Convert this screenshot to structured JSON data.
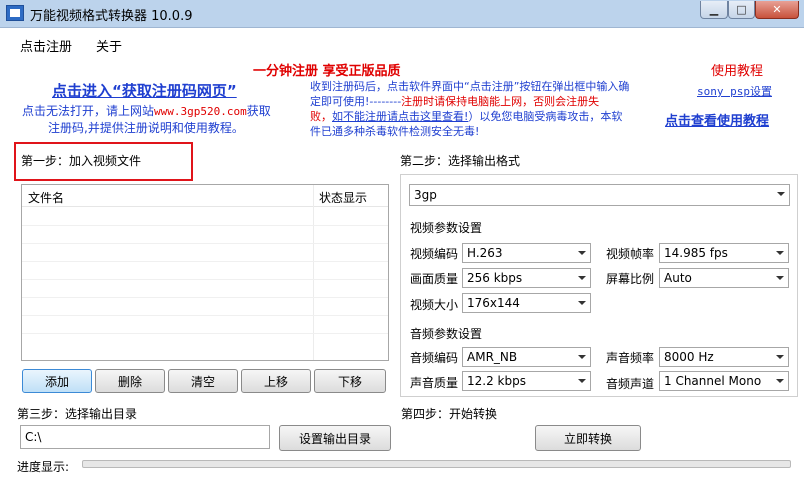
{
  "window": {
    "title": "万能视频格式转换器 10.0.9"
  },
  "menu": {
    "register": "点击注册",
    "about": "关于"
  },
  "promo": {
    "headline": "一分钟注册  享受正版品质",
    "get_code_link": "点击进入“获取注册码网页”",
    "cannot_open_prefix": "点击无法打开，请上网站",
    "site": "www.3gp520.com",
    "cannot_open_suffix": "获取",
    "cannot_open_line2": "注册码,并提供注册说明和使用教程。",
    "notice_line1": "收到注册码后，点击软件界面中“点击注册”按钮在弹出框中输入确",
    "notice_line2_a": "定即可使用!--------",
    "notice_line2_b": "注册时请保持电脑能上网，否则会注册失",
    "notice_line3_a": "败，",
    "notice_line3_link": "如不能注册请点击这里查看!",
    "notice_line3_b": "）以免您电脑受病毒攻击，本软",
    "notice_line4": "件已通多种杀毒软件检测安全无毒!",
    "tutorial_title": "使用教程",
    "psp_link": "sony psp设置",
    "tutorial_link": "点击查看使用教程"
  },
  "step1": {
    "label": "第一步：加入视频文件",
    "columns": [
      "文件名",
      "状态显示"
    ],
    "buttons": {
      "add": "添加",
      "delete": "删除",
      "clear": "清空",
      "up": "上移",
      "down": "下移"
    }
  },
  "step2": {
    "label": "第二步：选择输出格式",
    "format": "3gp",
    "video_section": "视频参数设置",
    "video": {
      "codec_label": "视频编码",
      "codec": "H.263",
      "fps_label": "视频帧率",
      "fps": "14.985 fps",
      "quality_label": "画面质量",
      "quality": "256 kbps",
      "ratio_label": "屏幕比例",
      "ratio": "Auto",
      "size_label": "视频大小",
      "size": "176x144"
    },
    "audio_section": "音频参数设置",
    "audio": {
      "codec_label": "音频编码",
      "codec": "AMR_NB",
      "rate_label": "声音频率",
      "rate": "8000 Hz",
      "quality_label": "声音质量",
      "quality": "12.2 kbps",
      "channel_label": "音频声道",
      "channel": "1 Channel Mono"
    }
  },
  "step3": {
    "label": "第三步：选择输出目录",
    "path": "C:\\",
    "set_button": "设置输出目录"
  },
  "step4": {
    "label": "第四步：开始转换",
    "start_button": "立即转换"
  },
  "progress": {
    "label": "进度显示:",
    "value": 0
  }
}
